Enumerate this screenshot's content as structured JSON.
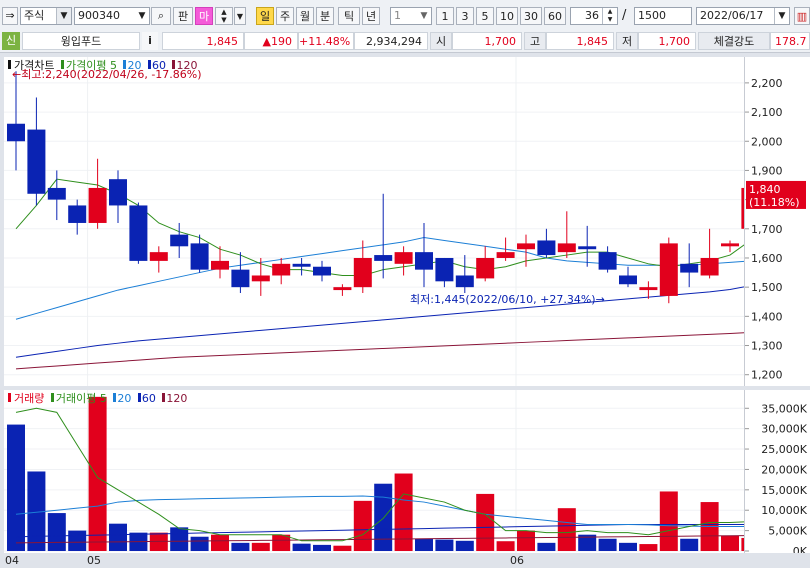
{
  "toolbar": {
    "market_type": "주식",
    "stock_code": "900340",
    "board_btn": "판",
    "margin_btn": "마",
    "period_tabs": [
      "일",
      "주",
      "월",
      "분",
      "틱",
      "년"
    ],
    "interval_value": "1",
    "interval_presets": [
      "1",
      "3",
      "5",
      "10",
      "30",
      "60"
    ],
    "display_count": "36",
    "total_count": "1500",
    "date": "2022/06/17"
  },
  "info_bar": {
    "badge": "신",
    "stock_name": "윙입푸드",
    "info_icon": "i",
    "price": "1,845",
    "change": "▲190",
    "change_pct": "+11.48%",
    "volume": "2,934,294",
    "open_label": "시",
    "open": "1,700",
    "high_label": "고",
    "high": "1,845",
    "low_label": "저",
    "low": "1,700",
    "strength_label": "체결강도",
    "strength": "178.7"
  },
  "colors": {
    "up": "#e1001c",
    "down": "#0a23b3",
    "ma5": "#2f8f1d",
    "ma20": "#1c7fd6",
    "ma60": "#0a23b3",
    "ma120": "#8a1538"
  },
  "chart_data": [
    {
      "type": "candlestick",
      "title": "가격차트",
      "legend": [
        "가격이평",
        "5",
        "20",
        "60",
        "120"
      ],
      "x_labels": [
        "04",
        "05",
        "06"
      ],
      "y_ticks": [
        1200,
        1300,
        1400,
        1500,
        1600,
        1700,
        1800,
        1900,
        2000,
        2100,
        2200
      ],
      "ylim": [
        1175,
        2275
      ],
      "candles": [
        {
          "o": 2060,
          "h": 2240,
          "l": 1900,
          "c": 2000
        },
        {
          "o": 2040,
          "h": 2150,
          "l": 1780,
          "c": 1820
        },
        {
          "o": 1840,
          "h": 1900,
          "l": 1730,
          "c": 1800
        },
        {
          "o": 1780,
          "h": 1800,
          "l": 1680,
          "c": 1720
        },
        {
          "o": 1720,
          "h": 1940,
          "l": 1700,
          "c": 1840
        },
        {
          "o": 1870,
          "h": 1900,
          "l": 1720,
          "c": 1780
        },
        {
          "o": 1780,
          "h": 1790,
          "l": 1580,
          "c": 1590
        },
        {
          "o": 1590,
          "h": 1640,
          "l": 1550,
          "c": 1620
        },
        {
          "o": 1680,
          "h": 1720,
          "l": 1600,
          "c": 1640
        },
        {
          "o": 1650,
          "h": 1680,
          "l": 1550,
          "c": 1560
        },
        {
          "o": 1560,
          "h": 1640,
          "l": 1530,
          "c": 1590
        },
        {
          "o": 1560,
          "h": 1620,
          "l": 1480,
          "c": 1500
        },
        {
          "o": 1520,
          "h": 1600,
          "l": 1470,
          "c": 1540
        },
        {
          "o": 1540,
          "h": 1600,
          "l": 1510,
          "c": 1580
        },
        {
          "o": 1580,
          "h": 1600,
          "l": 1540,
          "c": 1570
        },
        {
          "o": 1570,
          "h": 1590,
          "l": 1520,
          "c": 1540
        },
        {
          "o": 1490,
          "h": 1510,
          "l": 1470,
          "c": 1500
        },
        {
          "o": 1500,
          "h": 1660,
          "l": 1480,
          "c": 1600
        },
        {
          "o": 1610,
          "h": 1820,
          "l": 1530,
          "c": 1590
        },
        {
          "o": 1580,
          "h": 1640,
          "l": 1540,
          "c": 1620
        },
        {
          "o": 1620,
          "h": 1720,
          "l": 1500,
          "c": 1560
        },
        {
          "o": 1600,
          "h": 1600,
          "l": 1500,
          "c": 1520
        },
        {
          "o": 1540,
          "h": 1610,
          "l": 1480,
          "c": 1500
        },
        {
          "o": 1530,
          "h": 1640,
          "l": 1520,
          "c": 1600
        },
        {
          "o": 1600,
          "h": 1670,
          "l": 1590,
          "c": 1620
        },
        {
          "o": 1630,
          "h": 1680,
          "l": 1570,
          "c": 1650
        },
        {
          "o": 1660,
          "h": 1700,
          "l": 1600,
          "c": 1610
        },
        {
          "o": 1620,
          "h": 1760,
          "l": 1600,
          "c": 1650
        },
        {
          "o": 1640,
          "h": 1710,
          "l": 1570,
          "c": 1630
        },
        {
          "o": 1620,
          "h": 1640,
          "l": 1550,
          "c": 1560
        },
        {
          "o": 1540,
          "h": 1570,
          "l": 1500,
          "c": 1510
        },
        {
          "o": 1490,
          "h": 1520,
          "l": 1460,
          "c": 1500
        },
        {
          "o": 1470,
          "h": 1670,
          "l": 1445,
          "c": 1650
        },
        {
          "o": 1580,
          "h": 1650,
          "l": 1500,
          "c": 1550
        },
        {
          "o": 1540,
          "h": 1700,
          "l": 1530,
          "c": 1600
        },
        {
          "o": 1640,
          "h": 1660,
          "l": 1620,
          "c": 1650
        },
        {
          "o": 1700,
          "h": 1845,
          "l": 1700,
          "c": 1840
        }
      ],
      "ma5": [
        1700,
        1780,
        1870,
        1860,
        1850,
        1820,
        1780,
        1720,
        1690,
        1670,
        1630,
        1610,
        1580,
        1560,
        1560,
        1550,
        1540,
        1540,
        1560,
        1570,
        1580,
        1590,
        1570,
        1560,
        1570,
        1590,
        1600,
        1610,
        1620,
        1620,
        1600,
        1580,
        1570,
        1580,
        1590,
        1610,
        1660
      ],
      "ma20": [
        1390,
        1410,
        1430,
        1450,
        1470,
        1490,
        1505,
        1520,
        1535,
        1550,
        1565,
        1575,
        1585,
        1595,
        1605,
        1615,
        1625,
        1635,
        1645,
        1655,
        1670,
        1660,
        1650,
        1640,
        1630,
        1620,
        1600,
        1590,
        1585,
        1580,
        1575,
        1575,
        1575,
        1575,
        1580,
        1585,
        1590
      ],
      "ma60": [
        1260,
        1270,
        1280,
        1290,
        1300,
        1308,
        1316,
        1322,
        1328,
        1334,
        1340,
        1346,
        1352,
        1358,
        1364,
        1370,
        1376,
        1382,
        1388,
        1394,
        1400,
        1406,
        1412,
        1418,
        1424,
        1430,
        1436,
        1442,
        1448,
        1454,
        1460,
        1466,
        1472,
        1478,
        1484,
        1492,
        1505
      ],
      "ma120": [
        1220,
        1225,
        1230,
        1235,
        1240,
        1245,
        1250,
        1255,
        1260,
        1263,
        1266,
        1269,
        1272,
        1275,
        1278,
        1281,
        1284,
        1287,
        1290,
        1293,
        1296,
        1299,
        1302,
        1305,
        1308,
        1311,
        1314,
        1317,
        1320,
        1323,
        1326,
        1329,
        1332,
        1335,
        1338,
        1341,
        1345
      ],
      "annotations": {
        "high": "최고:2,240(2022/04/26, -17.86%)",
        "low": "최저:1,445(2022/06/10, +27.34%)",
        "last_price": "1,840",
        "last_pct": "(11.18%)"
      }
    },
    {
      "type": "bar",
      "title": "거래량",
      "legend": [
        "거래이평",
        "5",
        "20",
        "60",
        "120"
      ],
      "y_ticks": [
        "0K",
        "5,000K",
        "10,000K",
        "15,000K",
        "20,000K",
        "25,000K",
        "30,000K",
        "35,000K"
      ],
      "ylim": [
        0,
        38500
      ],
      "values": [
        31000,
        19500,
        9300,
        5000,
        37800,
        6700,
        4500,
        4500,
        5800,
        3500,
        4000,
        2000,
        2000,
        4000,
        1800,
        1500,
        1300,
        12300,
        16500,
        19000,
        3000,
        2800,
        2500,
        14000,
        2400,
        5000,
        2000,
        10500,
        4000,
        3000,
        2000,
        1700,
        14600,
        3000,
        12000,
        3800,
        3200
      ],
      "ma5": [
        34000,
        35000,
        34000,
        26000,
        18000,
        15000,
        12000,
        9000,
        5500,
        5000,
        4000,
        4000,
        4000,
        4000,
        2500,
        2500,
        2500,
        4000,
        8000,
        14000,
        13000,
        12000,
        10000,
        9000,
        5000,
        5000,
        4500,
        4500,
        5000,
        4500,
        4500,
        4000,
        5000,
        6000,
        7000,
        7000,
        7200
      ],
      "ma20": [
        9000,
        9500,
        10000,
        10500,
        11000,
        12000,
        12400,
        12600,
        12700,
        12800,
        12900,
        13000,
        13100,
        13200,
        13300,
        13400,
        13400,
        13500,
        13200,
        12500,
        12000,
        11000,
        10000,
        9000,
        8500,
        8000,
        7500,
        7000,
        6500,
        6500,
        6500,
        6400,
        6200,
        6100,
        6000,
        6000,
        6000
      ],
      "ma60": [
        3500,
        3600,
        3700,
        3800,
        3900,
        4000,
        4100,
        4200,
        4300,
        4400,
        4500,
        4600,
        4700,
        4800,
        4900,
        5000,
        5100,
        5200,
        5300,
        5400,
        5500,
        5600,
        5700,
        5800,
        5900,
        6000,
        6100,
        6200,
        6300,
        6400,
        6500,
        6500,
        6500,
        6500,
        6500,
        6500,
        6500
      ],
      "ma120": [
        2000,
        2050,
        2100,
        2150,
        2200,
        2250,
        2300,
        2350,
        2400,
        2450,
        2500,
        2550,
        2600,
        2650,
        2700,
        2750,
        2800,
        2850,
        2900,
        2950,
        3000,
        3050,
        3100,
        3150,
        3200,
        3250,
        3300,
        3350,
        3400,
        3450,
        3500,
        3550,
        3600,
        3650,
        3700,
        3750,
        3800
      ]
    }
  ]
}
